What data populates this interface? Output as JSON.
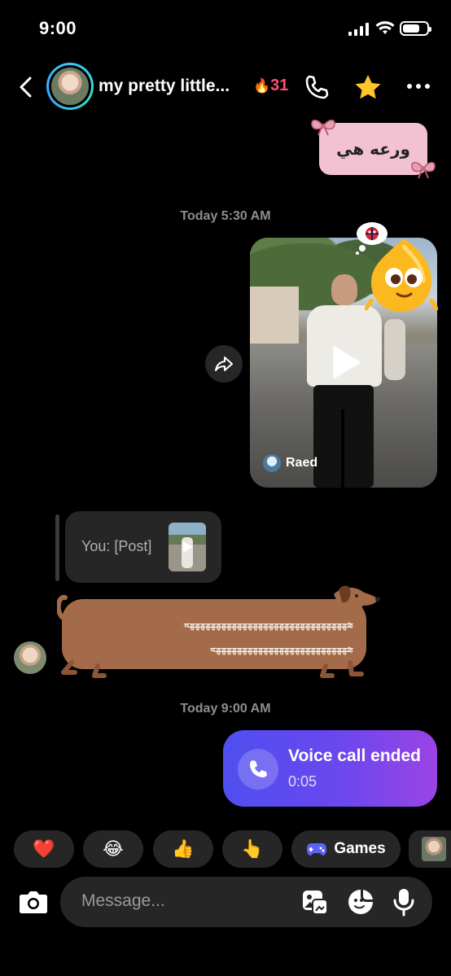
{
  "status_bar": {
    "time": "9:00"
  },
  "header": {
    "title": "my pretty little...",
    "streak_count": "31",
    "streak_emoji": "🔥"
  },
  "messages": {
    "sticker_text": "ورعه هي",
    "timestamp_1": "Today 5:30 AM",
    "video_author": "Raed",
    "reply_preview": "You: [Post]",
    "dog_line_1": "هههههههههههههههههههههههههههههههه",
    "dog_line_2": "ههههههههههههههههههههههههههه",
    "timestamp_2": "Today 9:00 AM",
    "call_title": "Voice call ended",
    "call_duration": "0:05"
  },
  "quick_replies": {
    "heart": "❤️",
    "laugh": "😂",
    "thumbs": "👍",
    "point": "👆",
    "games": "Games"
  },
  "composer": {
    "placeholder": "Message..."
  },
  "colors": {
    "call_gradient_start": "#4f4ff0",
    "call_gradient_end": "#9b44e4",
    "sticker_pink": "#f2c2d2",
    "streak": "#ff4d6d"
  }
}
